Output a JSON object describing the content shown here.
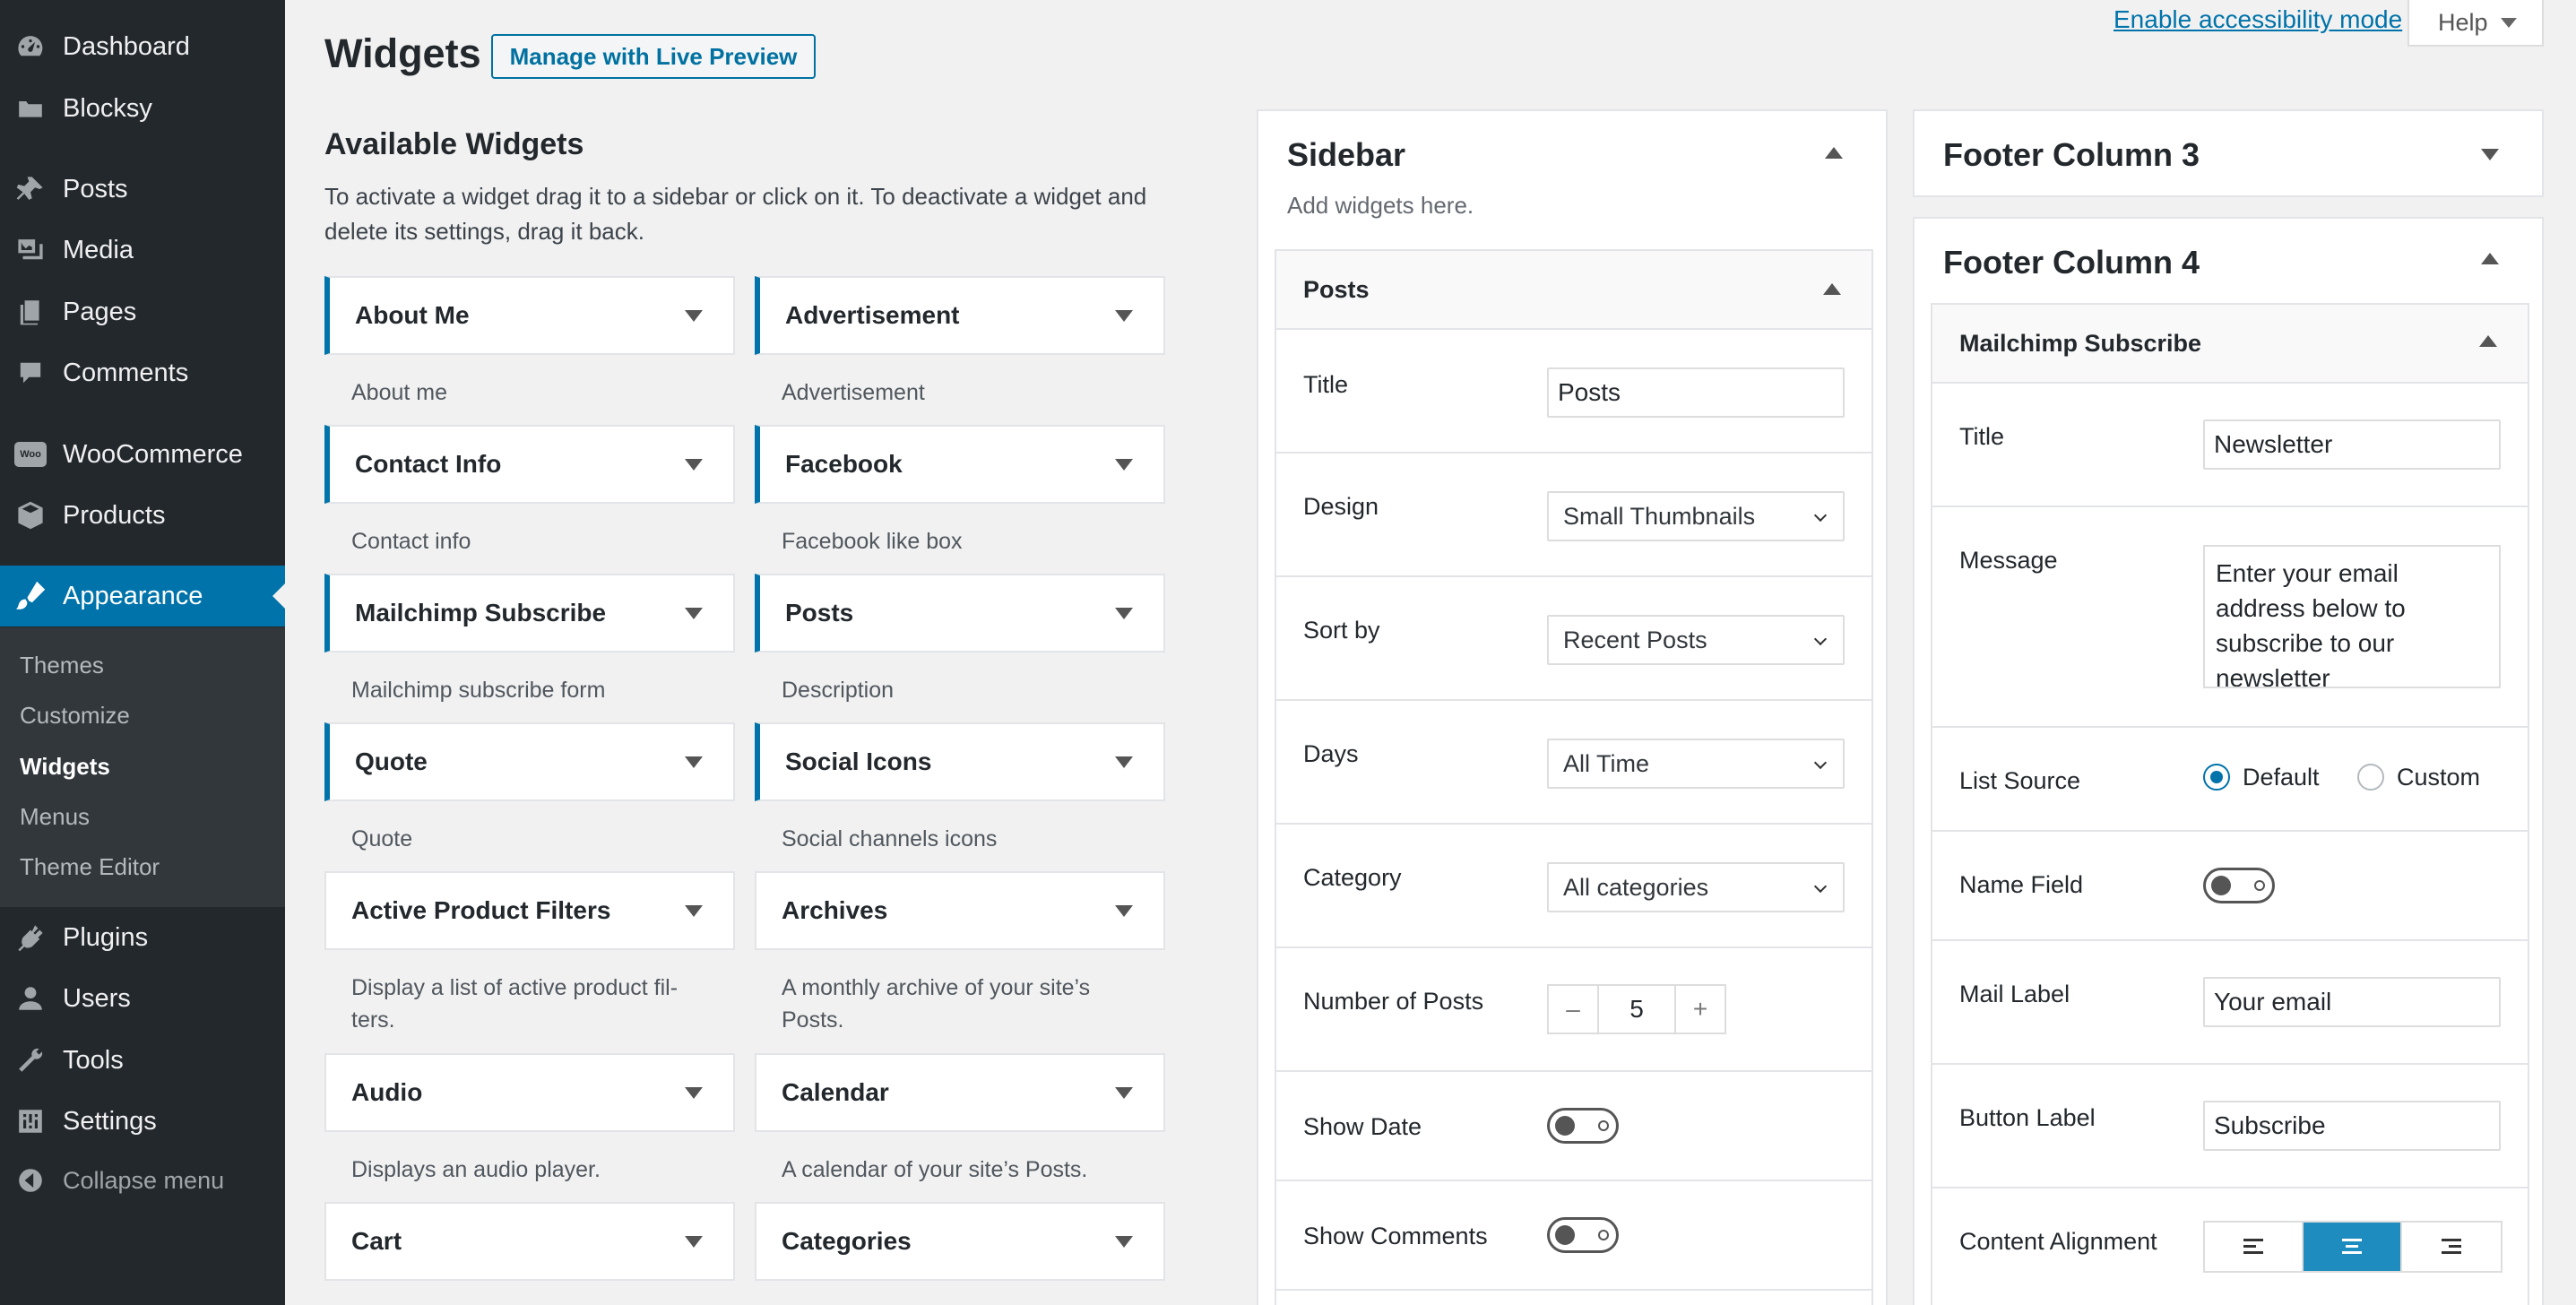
{
  "menu": {
    "top": [
      {
        "label": "Dashboard",
        "icon": "dashboard-icon"
      },
      {
        "label": "Blocksy",
        "icon": "blocksy-icon"
      }
    ],
    "group2": [
      {
        "label": "Posts",
        "icon": "pin-icon"
      },
      {
        "label": "Media",
        "icon": "media-icon"
      },
      {
        "label": "Pages",
        "icon": "pages-icon"
      },
      {
        "label": "Comments",
        "icon": "comments-icon"
      }
    ],
    "group3": [
      {
        "label": "WooCommerce",
        "icon": "woocommerce-icon",
        "badge": "Woo"
      },
      {
        "label": "Products",
        "icon": "products-icon"
      }
    ],
    "current": {
      "label": "Appearance",
      "icon": "appearance-icon"
    },
    "submenu": [
      "Themes",
      "Customize",
      "Widgets",
      "Menus",
      "Theme Editor"
    ],
    "submenu_active": "Widgets",
    "bottom": [
      {
        "label": "Plugins",
        "icon": "plugins-icon"
      },
      {
        "label": "Users",
        "icon": "users-icon"
      },
      {
        "label": "Tools",
        "icon": "tools-icon"
      },
      {
        "label": "Settings",
        "icon": "settings-icon"
      }
    ],
    "collapse": "Collapse menu"
  },
  "header": {
    "title": "Widgets",
    "live_preview": "Manage with Live Preview",
    "accessibility": "Enable accessibility mode",
    "help": "Help"
  },
  "available": {
    "heading": "Available Widgets",
    "description": "To activate a widget drag it to a sidebar or click on it. To deactivate a widget and delete its settings, drag it back.",
    "widgets": [
      {
        "name": "About Me",
        "desc": "About me",
        "highlight": true
      },
      {
        "name": "Advertisement",
        "desc": "Advertisement",
        "highlight": true
      },
      {
        "name": "Contact Info",
        "desc": "Contact info",
        "highlight": true
      },
      {
        "name": "Facebook",
        "desc": "Facebook like box",
        "highlight": true
      },
      {
        "name": "Mailchimp Subscribe",
        "desc": "Mailchimp subscribe form",
        "highlight": true
      },
      {
        "name": "Posts",
        "desc": "Description",
        "highlight": true
      },
      {
        "name": "Quote",
        "desc": "Quote",
        "highlight": true
      },
      {
        "name": "Social Icons",
        "desc": "Social channels icons",
        "highlight": true
      },
      {
        "name": "Active Product Filters",
        "desc": "Display a list of active product fil-\nters.",
        "highlight": false
      },
      {
        "name": "Archives",
        "desc": "A monthly archive of your site’s\nPosts.",
        "highlight": false
      },
      {
        "name": "Audio",
        "desc": "Displays an audio player.",
        "highlight": false
      },
      {
        "name": "Calendar",
        "desc": "A calendar of your site’s Posts.",
        "highlight": false
      },
      {
        "name": "Cart",
        "desc": "",
        "highlight": false
      },
      {
        "name": "Categories",
        "desc": "",
        "highlight": false
      }
    ]
  },
  "sidebar": {
    "title": "Sidebar",
    "hint": "Add widgets here.",
    "widget": {
      "title": "Posts",
      "fields": {
        "title_label": "Title",
        "title_value": "Posts",
        "design_label": "Design",
        "design_value": "Small Thumbnails",
        "sort_label": "Sort by",
        "sort_value": "Recent Posts",
        "days_label": "Days",
        "days_value": "All Time",
        "category_label": "Category",
        "category_value": "All categories",
        "number_label": "Number of Posts",
        "number_value": "5",
        "minus": "–",
        "plus": "+",
        "show_date_label": "Show Date",
        "show_date": false,
        "show_comments_label": "Show Comments",
        "show_comments": false
      }
    }
  },
  "footer3": {
    "title": "Footer Column 3"
  },
  "footer4": {
    "title": "Footer Column 4",
    "widget": {
      "title": "Mailchimp Subscribe",
      "title_label": "Title",
      "title_value": "Newsletter",
      "message_label": "Message",
      "message_value": "Enter your email address below to subscribe to our newsletter",
      "list_source_label": "List Source",
      "list_source_default": "Default",
      "list_source_custom": "Custom",
      "list_source_selected": "Default",
      "name_field_label": "Name Field",
      "name_field": false,
      "mail_label_label": "Mail Label",
      "mail_label_value": "Your email",
      "button_label_label": "Button Label",
      "button_label_value": "Subscribe",
      "alignment_label": "Content Alignment",
      "alignment": "center"
    }
  },
  "colors": {
    "accent": "#0073aa",
    "menu_bg": "#23282d",
    "submenu_bg": "#32373c",
    "active_align": "#1e8cbe"
  }
}
